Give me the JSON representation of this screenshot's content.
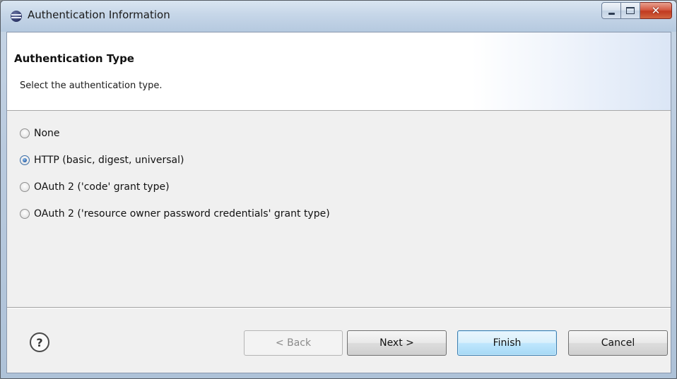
{
  "window": {
    "title": "Authentication Information",
    "controls": {
      "minimize": "—",
      "maximize": "□",
      "close": "✕"
    }
  },
  "header": {
    "title": "Authentication Type",
    "description": "Select the authentication type."
  },
  "options": [
    {
      "label": "None",
      "selected": false
    },
    {
      "label": "HTTP (basic, digest, universal)",
      "selected": true
    },
    {
      "label": "OAuth 2 ('code' grant type)",
      "selected": false
    },
    {
      "label": "OAuth 2 ('resource owner password credentials' grant type)",
      "selected": false
    }
  ],
  "footer": {
    "help_icon": "?",
    "back_label": "< Back",
    "next_label": "Next >",
    "finish_label": "Finish",
    "cancel_label": "Cancel"
  }
}
